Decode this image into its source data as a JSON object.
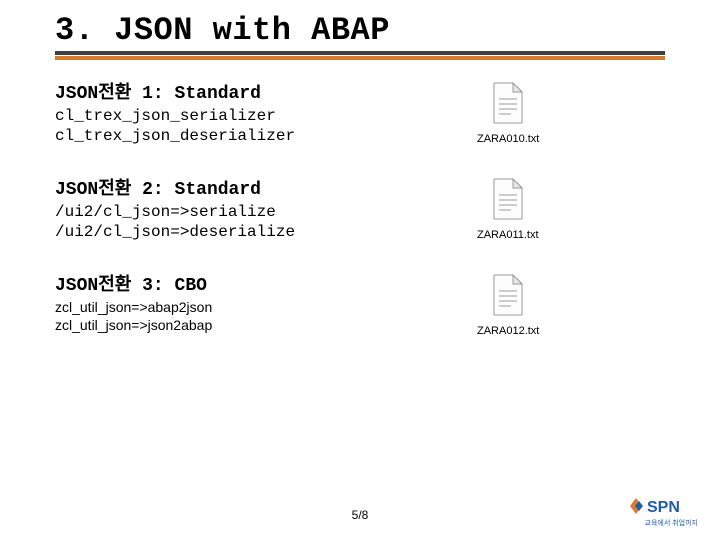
{
  "title": "3. JSON with ABAP",
  "sections": [
    {
      "heading": "JSON전환 1: Standard",
      "lines": [
        "cl_trex_json_serializer",
        "cl_trex_json_deserializer"
      ],
      "file": "ZARA010.txt",
      "mono": true
    },
    {
      "heading": "JSON전환 2: Standard",
      "lines": [
        "/ui2/cl_json=>serialize",
        "/ui2/cl_json=>deserialize"
      ],
      "file": "ZARA011.txt",
      "mono": true
    },
    {
      "heading": "JSON전환 3: CBO",
      "lines": [
        "zcl_util_json=>abap2json",
        "zcl_util_json=>json2abap"
      ],
      "file": "ZARA012.txt",
      "mono": false
    }
  ],
  "page": "5/8",
  "logo": {
    "name": "SPN",
    "tagline": "교육에서 취업까지"
  }
}
